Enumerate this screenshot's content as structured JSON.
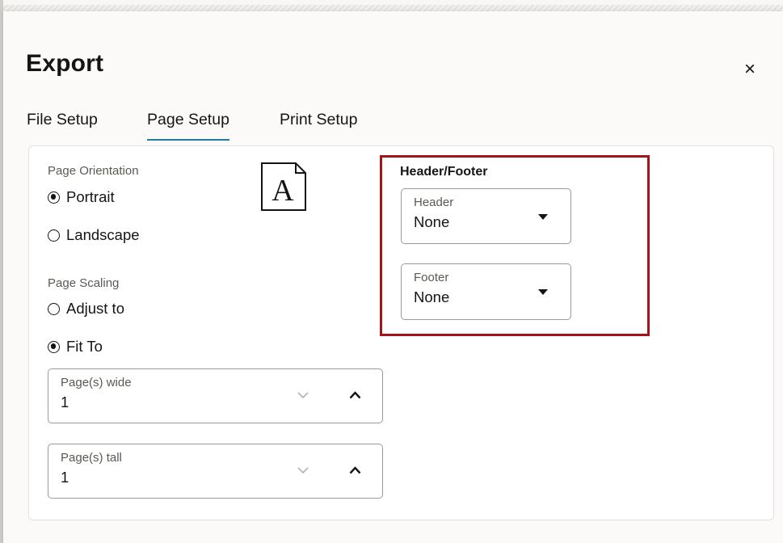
{
  "dialog": {
    "title": "Export",
    "close_label": "×"
  },
  "tabs": [
    {
      "label": "File Setup",
      "active": false
    },
    {
      "label": "Page Setup",
      "active": true
    },
    {
      "label": "Print Setup",
      "active": false
    }
  ],
  "orientation": {
    "label": "Page Orientation",
    "options": [
      {
        "label": "Portrait",
        "checked": true
      },
      {
        "label": "Landscape",
        "checked": false
      }
    ],
    "preview_icon": "portrait-page-icon",
    "preview_letter": "A"
  },
  "scaling": {
    "label": "Page Scaling",
    "options": [
      {
        "label": "Adjust to",
        "checked": false
      },
      {
        "label": "Fit To",
        "checked": true
      }
    ],
    "pages_wide": {
      "label": "Page(s) wide",
      "value": "1"
    },
    "pages_tall": {
      "label": "Page(s) tall",
      "value": "1"
    }
  },
  "header_footer": {
    "title": "Header/Footer",
    "header": {
      "label": "Header",
      "value": "None"
    },
    "footer": {
      "label": "Footer",
      "value": "None"
    }
  },
  "colors": {
    "accent_tab": "#227e9e",
    "highlight": "#a3151b"
  }
}
